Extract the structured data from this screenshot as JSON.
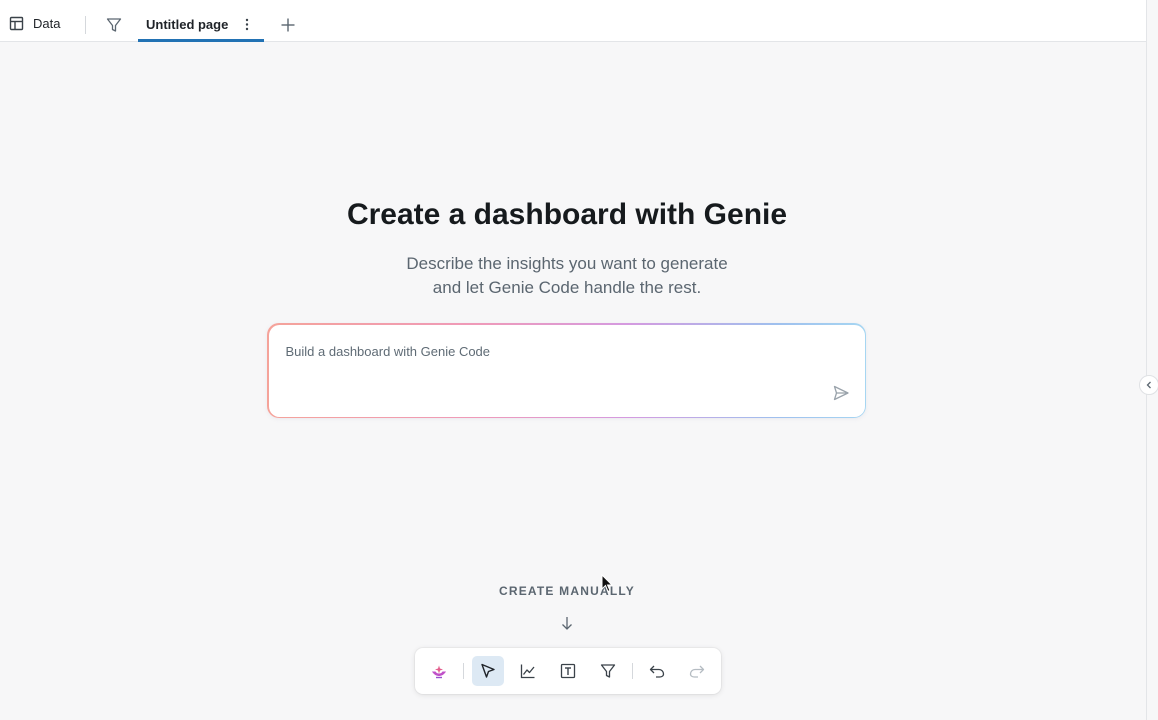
{
  "tabs": {
    "data_label": "Data",
    "page_label": "Untitled page"
  },
  "hero": {
    "title": "Create a dashboard with Genie",
    "subtitle_line1": "Describe the insights you want to generate",
    "subtitle_line2": "and let Genie Code handle the rest."
  },
  "prompt": {
    "placeholder": "Build a dashboard with Genie Code"
  },
  "create_manually": {
    "label": "CREATE MANUALLY"
  },
  "toolbar": {
    "tools": [
      {
        "name": "genie-icon",
        "active": false
      },
      {
        "name": "select-icon",
        "active": true
      },
      {
        "name": "chart-icon",
        "active": false
      },
      {
        "name": "text-icon",
        "active": false
      },
      {
        "name": "filter-icon",
        "active": false
      },
      {
        "name": "undo-icon",
        "active": false
      },
      {
        "name": "redo-icon",
        "active": false,
        "disabled": true
      }
    ]
  },
  "colors": {
    "accent": "#2272b4",
    "active_tool_bg": "#dde9f4",
    "background": "#f7f7f8"
  }
}
